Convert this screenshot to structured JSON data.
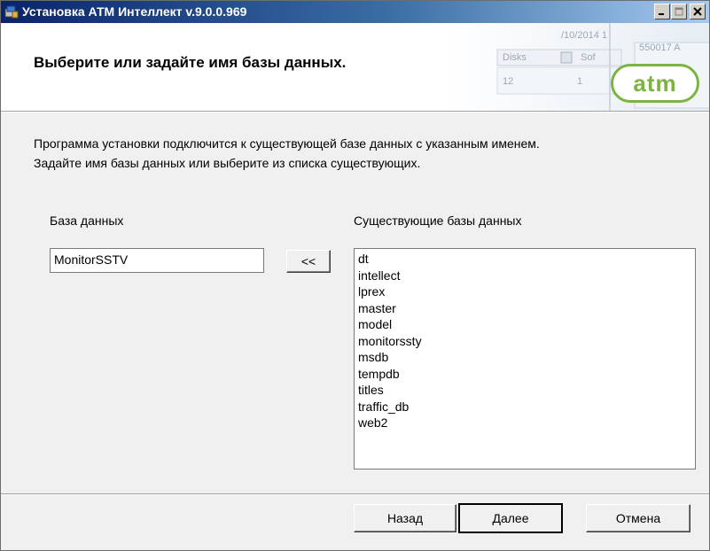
{
  "window": {
    "title": "Установка АТМ Интеллект v.9.0.0.969",
    "controls": {
      "minimize": "minimize-icon",
      "maximize": "maximize-icon",
      "close": "close-icon"
    }
  },
  "banner": {
    "title": "Выберите или задайте имя базы данных.",
    "logo_text": "atm",
    "background_fragments": [
      "/10/2014 1",
      "550017 A",
      "Disks",
      "Sof",
      "12",
      "1"
    ]
  },
  "description": {
    "line1": "Программа установки подключится к существующей базе данных с указанным именем.",
    "line2": "Задайте имя базы данных или выберите из списка существующих."
  },
  "database": {
    "label": "База данных",
    "value": "MonitorSSTV",
    "select_button": "<<"
  },
  "existing": {
    "label": "Существующие базы данных",
    "items": [
      "dt",
      "intellect",
      "lprex",
      "master",
      "model",
      "monitorssty",
      "msdb",
      "tempdb",
      "titles",
      "traffic_db",
      "web2"
    ]
  },
  "buttons": {
    "back": "Назад",
    "next": "Далее",
    "cancel": "Отмена"
  },
  "colors": {
    "titlebar_start": "#0a246a",
    "titlebar_end": "#a6caf0",
    "logo_green": "#7cb342",
    "dialog_bg": "#f0f0f0"
  }
}
